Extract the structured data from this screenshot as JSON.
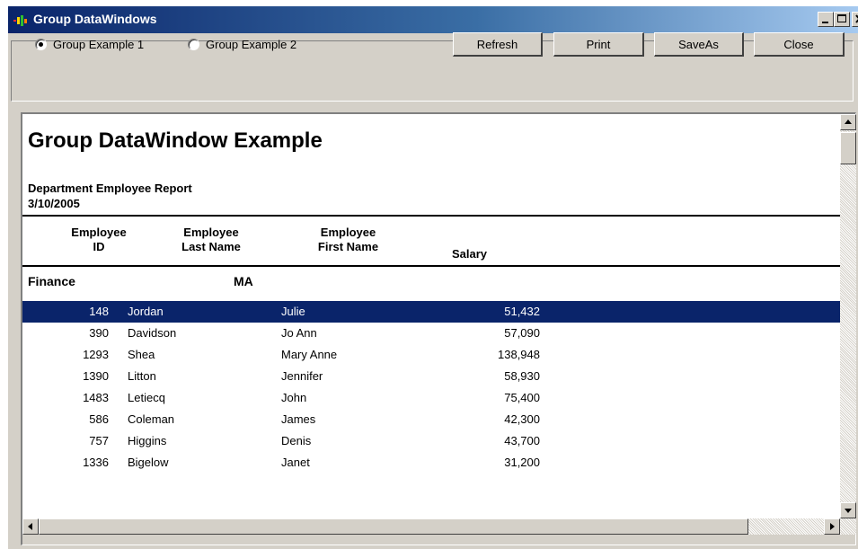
{
  "window": {
    "title": "Group DataWindows",
    "title_gradient": [
      "#0a246a",
      "#a6caf0"
    ]
  },
  "toolbar": {
    "radio_options": [
      {
        "label": "Group Example 1",
        "selected": true
      },
      {
        "label": "Group Example 2",
        "selected": false
      }
    ],
    "buttons": {
      "refresh": "Refresh",
      "print": "Print",
      "saveas": "SaveAs",
      "close": "Close"
    }
  },
  "report": {
    "title": "Group DataWindow Example",
    "subtitle": "Department Employee Report",
    "date": "3/10/2005",
    "columns": {
      "emp_id": [
        "Employee",
        "ID"
      ],
      "last_name": [
        "Employee",
        "Last Name"
      ],
      "first_name": [
        "Employee",
        "First Name"
      ],
      "salary": "Salary"
    },
    "group": {
      "name": "Finance",
      "state": "MA"
    },
    "rows": [
      {
        "id": "148",
        "last": "Jordan",
        "first": "Julie",
        "salary": "51,432",
        "selected": true
      },
      {
        "id": "390",
        "last": "Davidson",
        "first": "Jo Ann",
        "salary": "57,090",
        "selected": false
      },
      {
        "id": "1293",
        "last": "Shea",
        "first": "Mary Anne",
        "salary": "138,948",
        "selected": false
      },
      {
        "id": "1390",
        "last": "Litton",
        "first": "Jennifer",
        "salary": "58,930",
        "selected": false
      },
      {
        "id": "1483",
        "last": "Letiecq",
        "first": "John",
        "salary": "75,400",
        "selected": false
      },
      {
        "id": "586",
        "last": "Coleman",
        "first": "James",
        "salary": "42,300",
        "selected": false
      },
      {
        "id": "757",
        "last": "Higgins",
        "first": "Denis",
        "salary": "43,700",
        "selected": false
      },
      {
        "id": "1336",
        "last": "Bigelow",
        "first": "Janet",
        "salary": "31,200",
        "selected": false
      }
    ],
    "selection_color": "#0a246a"
  },
  "icons": {
    "app": "app-icon",
    "minimize": "minimize-icon",
    "maximize": "maximize-icon",
    "close": "close-x-icon",
    "scroll_up": "arrow-up-icon",
    "scroll_down": "arrow-down-icon",
    "scroll_left": "arrow-left-icon",
    "scroll_right": "arrow-right-icon"
  }
}
